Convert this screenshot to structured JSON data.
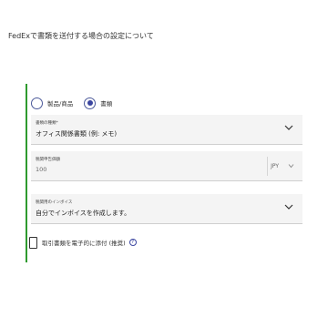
{
  "header": {
    "title": "FedExで書類を送付する場合の設定について"
  },
  "shipment_type": {
    "options": [
      {
        "label": "製品/商品",
        "checked": false,
        "icon": "radio-unchecked-icon"
      },
      {
        "label": "書類",
        "checked": true,
        "icon": "radio-checked-icon"
      }
    ]
  },
  "document_type": {
    "label": "書類の種類*",
    "value": "オフィス関係書類 (例: メモ)",
    "icon": "chevron-down-icon"
  },
  "customs_value": {
    "label": "税関申告価額",
    "value": "100",
    "currency": "JPY",
    "icon": "chevron-down-icon"
  },
  "invoice_type": {
    "label": "税関用のインボイス",
    "value": "自分でインボイスを作成します。",
    "icon": "chevron-down-icon"
  },
  "etd": {
    "label": "取引書類を電子的に添付 (推奨)",
    "checked": false,
    "help_icon": "help-icon",
    "help_glyph": "?"
  },
  "colors": {
    "accent": "#2e9a2e",
    "radio": "#3b46a0"
  }
}
